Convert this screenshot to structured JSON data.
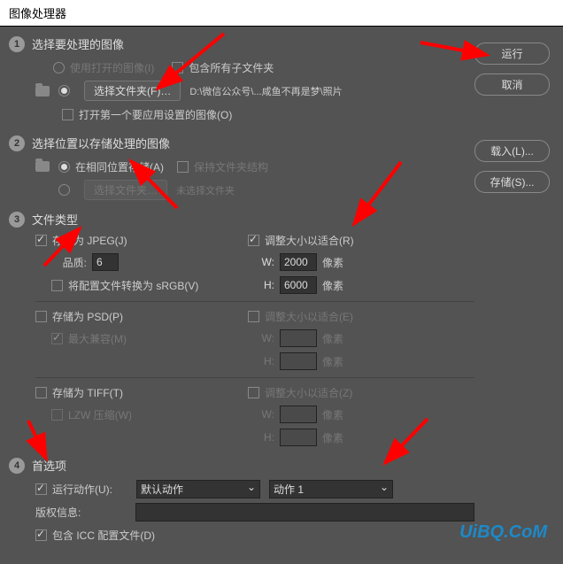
{
  "title": "图像处理器",
  "buttons": {
    "run": "运行",
    "cancel": "取消",
    "load": "载入(L)...",
    "save": "存储(S)..."
  },
  "section1": {
    "title": "选择要处理的图像",
    "useOpen": "使用打开的图像(I)",
    "includeSub": "包含所有子文件夹",
    "selectFolder": "选择文件夹(F)…",
    "path": "D:\\微信公众号\\...咸鱼不再是梦\\照片",
    "openFirst": "打开第一个要应用设置的图像(O)"
  },
  "section2": {
    "title": "选择位置以存储处理的图像",
    "sameLoc": "在相同位置存储(A)",
    "keepStruct": "保持文件夹结构",
    "selectFolder": "选择文件夹…",
    "noFolder": "未选择文件夹"
  },
  "section3": {
    "title": "文件类型",
    "saveJpeg": "存储为 JPEG(J)",
    "resizeFitR": "调整大小以适合(R)",
    "quality": "品质:",
    "qualityVal": "6",
    "w": "W:",
    "h": "H:",
    "jpegW": "2000",
    "jpegH": "6000",
    "px": "像素",
    "srgb": "将配置文件转换为 sRGB(V)",
    "savePsd": "存储为 PSD(P)",
    "resizeFitE": "调整大小以适合(E)",
    "maxCompat": "最大兼容(M)",
    "saveTiff": "存储为 TIFF(T)",
    "resizeFitZ": "调整大小以适合(Z)",
    "lzw": "LZW 压缩(W)"
  },
  "section4": {
    "title": "首选项",
    "runAction": "运行动作(U):",
    "actionSet": "默认动作",
    "action": "动作 1",
    "copyright": "版权信息:",
    "icc": "包含 ICC 配置文件(D)"
  },
  "watermark": "UiBQ.CoM"
}
